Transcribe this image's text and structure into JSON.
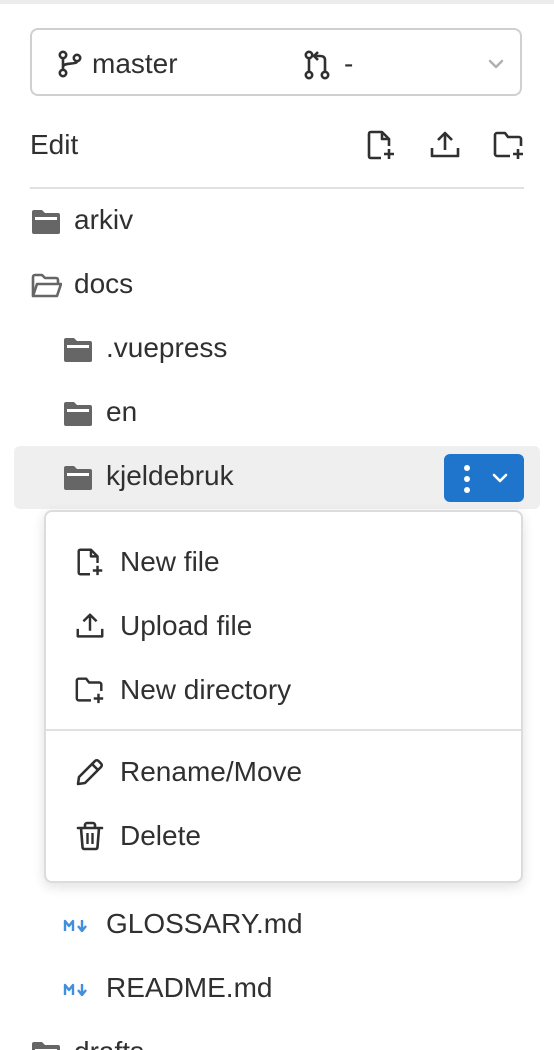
{
  "branch": {
    "name": "master",
    "merge_request_value": "-"
  },
  "toolbar": {
    "edit_label": "Edit",
    "new_file_tooltip": "New file",
    "upload_tooltip": "Upload file",
    "new_directory_tooltip": "New directory"
  },
  "tree": {
    "items": [
      {
        "label": "arkiv",
        "type": "folder",
        "state": "closed"
      },
      {
        "label": "docs",
        "type": "folder",
        "state": "open"
      },
      {
        "label": ".vuepress",
        "type": "folder",
        "state": "closed"
      },
      {
        "label": "en",
        "type": "folder",
        "state": "closed"
      },
      {
        "label": "kjeldebruk",
        "type": "folder",
        "state": "closed",
        "selected": true
      },
      {
        "label": "GLOSSARY.md",
        "type": "markdown"
      },
      {
        "label": "README.md",
        "type": "markdown"
      },
      {
        "label": "drafts",
        "type": "folder",
        "state": "closed"
      }
    ]
  },
  "context_menu": {
    "items": [
      {
        "label": "New file",
        "icon": "new-file-icon"
      },
      {
        "label": "Upload file",
        "icon": "upload-icon"
      },
      {
        "label": "New directory",
        "icon": "new-directory-icon"
      },
      {
        "label": "Rename/Move",
        "icon": "pencil-icon"
      },
      {
        "label": "Delete",
        "icon": "trash-icon"
      }
    ]
  },
  "colors": {
    "accent": "#1f75cb",
    "markdown_icon": "#428fdc",
    "text": "#303030",
    "icon": "#5e5e5e"
  }
}
